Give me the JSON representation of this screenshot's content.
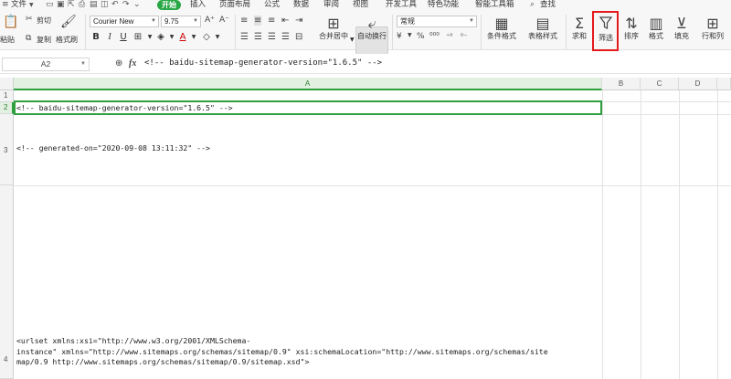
{
  "menubar": {
    "file_label": "文件",
    "start_tab": "开始",
    "tabs": [
      "插入",
      "页面布局",
      "公式",
      "数据",
      "审阅",
      "视图",
      "开发工具",
      "特色功能",
      "智能工具箱"
    ],
    "search_label": "查找"
  },
  "ribbon": {
    "paste": "粘贴",
    "cut": "剪切",
    "copy": "复制",
    "format_painter": "格式刷",
    "font_name": "Courier New",
    "font_size": "9.75",
    "merge_center": "合并居中",
    "wrap_text": "自动换行",
    "number_format": "常规",
    "conditional_format": "条件格式",
    "table_style": "表格样式",
    "sum": "求和",
    "filter": "筛选",
    "sort": "排序",
    "format": "格式",
    "fill": "填充",
    "row_col": "行和列"
  },
  "formula_bar": {
    "cell_ref": "A2",
    "content": "<!-- baidu-sitemap-generator-version=\"1.6.5\" -->"
  },
  "grid": {
    "columns": [
      "A",
      "B",
      "C",
      "D"
    ],
    "rows": [
      "1",
      "2",
      "3",
      "4"
    ],
    "cells": {
      "a2": "<!-- baidu-sitemap-generator-version=\"1.6.5\" -->",
      "a3": "<!-- generated-on=\"2020-09-08 13:11:32\" -->",
      "a4": "<urlset xmlns:xsi=\"http://www.w3.org/2001/XMLSchema-\ninstance\" xmlns=\"http://www.sitemaps.org/schemas/sitemap/0.9\" xsi:schemaLocation=\"http://www.sitemaps.org/schemas/site\nmap/0.9 http://www.sitemaps.org/schemas/sitemap/0.9/sitemap.xsd\">"
    }
  },
  "colors": {
    "start_tab": "#28a745",
    "selection": "#2e9e3e",
    "highlight": "#e51a1a"
  }
}
